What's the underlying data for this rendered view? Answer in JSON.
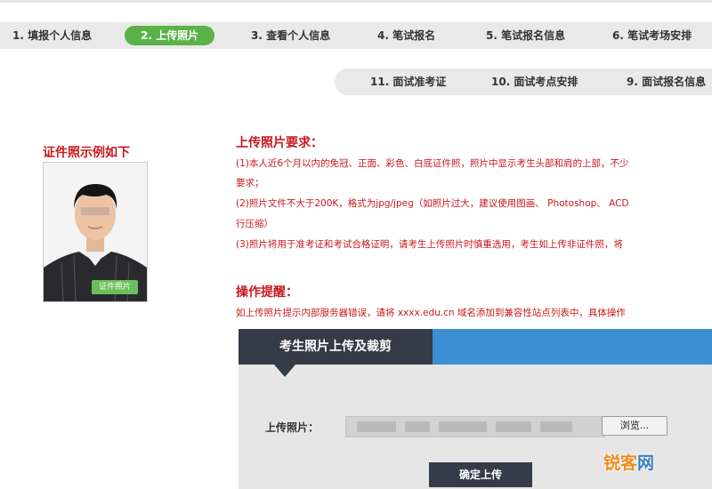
{
  "steps_row1": [
    {
      "label": "1. 填报个人信息",
      "active": false
    },
    {
      "label": "2. 上传照片",
      "active": true
    },
    {
      "label": "3. 查看个人信息",
      "active": false
    },
    {
      "label": "4. 笔试报名",
      "active": false
    },
    {
      "label": "5. 笔试报名信息",
      "active": false
    },
    {
      "label": "6. 笔试考场安排",
      "active": false
    }
  ],
  "steps_row2": [
    {
      "label": "11. 面试准考证"
    },
    {
      "label": "10. 面试考点安排"
    },
    {
      "label": "9. 面试报名信息"
    }
  ],
  "sample": {
    "title": "证件照示例如下",
    "badge": "证件照片"
  },
  "requirements": {
    "title": "上传照片要求：",
    "lines": [
      "(1)本人近6个月以内的免冠、正面、彩色、白底证件照，照片中显示考生头部和肩的上部，不少",
      "要求；",
      "(2)照片文件不大于200K，格式为jpg/jpeg（如照片过大，建议使用图画、 Photoshop、 ACD",
      "行压缩）",
      "(3)照片将用于准考证和考试合格证明，请考生上传照片时慎重选用，考生如上传非证件照，将"
    ]
  },
  "operation": {
    "title": "操作提醒：",
    "text": "如上传照片提示内部服务器错误，请将 xxxx.edu.cn 域名添加到兼容性站点列表中，具体操作"
  },
  "upload_panel": {
    "title": "考生照片上传及裁剪",
    "field_label": "上传照片：",
    "browse_label": "浏览...",
    "confirm_label": "确定上传"
  },
  "watermark": {
    "part1": "锐客",
    "part2": "网"
  },
  "colors": {
    "accent_red": "#c8181e",
    "active_green": "#5ab146",
    "panel_dark": "#333c47",
    "panel_blue": "#3d8fd3"
  }
}
